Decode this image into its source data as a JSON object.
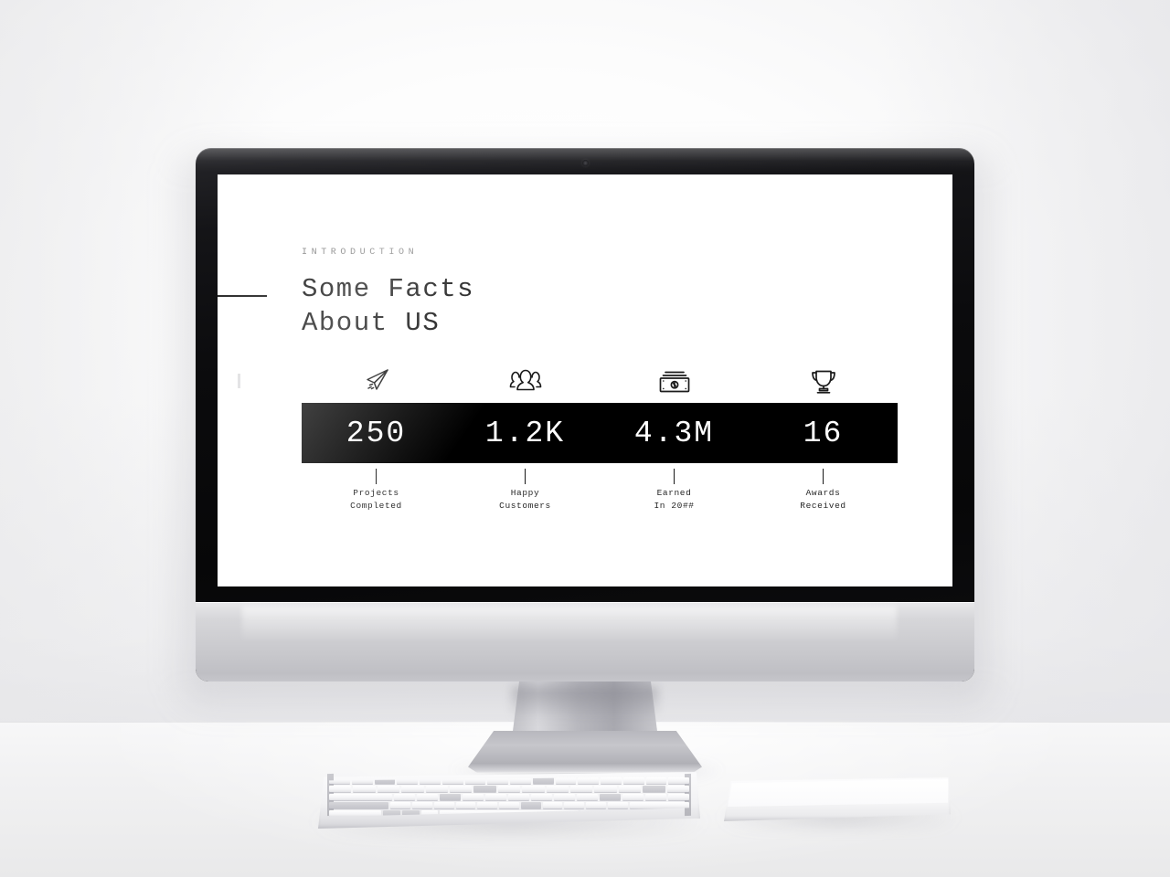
{
  "scene": {
    "device": "imac-desktop-mockup",
    "peripherals": [
      "keyboard",
      "trackpad"
    ]
  },
  "slide": {
    "kicker": "INTRODUCTION",
    "headline": "Some Facts\nAbout US",
    "accent_color": "#000000",
    "text_color": "#121212",
    "kicker_color": "#7c7c7c",
    "bar_background": "#000000",
    "bar_text_color": "#ffffff",
    "stats": [
      {
        "icon": "paper-plane-icon",
        "value": "250",
        "label": "Projects\nCompleted"
      },
      {
        "icon": "people-group-icon",
        "value": "1.2K",
        "label": "Happy\nCustomers"
      },
      {
        "icon": "banknotes-icon",
        "value": "4.3M",
        "label": "Earned\nIn 20##"
      },
      {
        "icon": "trophy-icon",
        "value": "16",
        "label": "Awards\nReceived"
      }
    ]
  }
}
